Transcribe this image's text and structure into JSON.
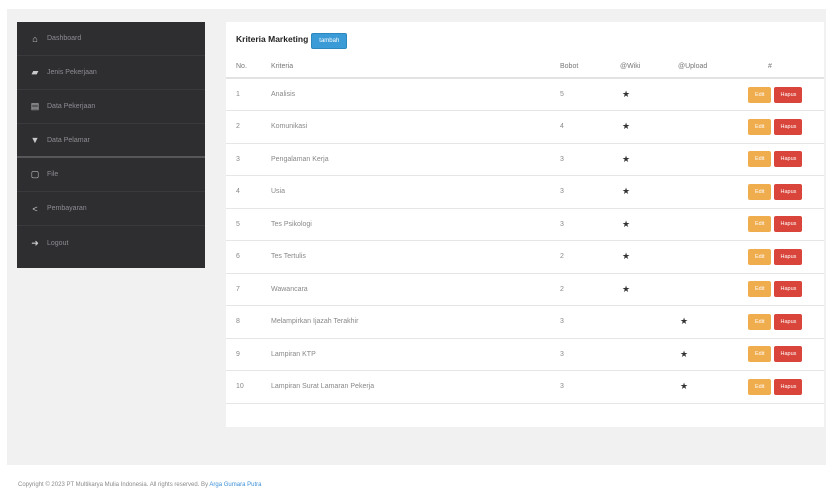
{
  "sidebar": {
    "items": [
      {
        "label": "Dashboard",
        "icon": "home-icon"
      },
      {
        "label": "Jenis Pekerjaan",
        "icon": "briefcase-icon"
      },
      {
        "label": "Data Pekerjaan",
        "icon": "list-icon"
      },
      {
        "label": "Data Pelamar",
        "icon": "users-icon"
      },
      {
        "label": "File",
        "icon": "file-icon"
      },
      {
        "label": "Pembayaran",
        "icon": "share-icon"
      },
      {
        "label": "Logout",
        "icon": "logout-icon"
      }
    ]
  },
  "panel": {
    "title": "Kriteria Marketing",
    "add_button": "tambah"
  },
  "table": {
    "headers": [
      "No.",
      "Kriteria",
      "Bobot",
      "@Wiki",
      "@Upload",
      "#"
    ],
    "rows": [
      {
        "no": "1",
        "kriteria": "Analisis",
        "bobot": "5",
        "wiki": true,
        "upload": false
      },
      {
        "no": "2",
        "kriteria": "Komunikasi",
        "bobot": "4",
        "wiki": true,
        "upload": false
      },
      {
        "no": "3",
        "kriteria": "Pengalaman Kerja",
        "bobot": "3",
        "wiki": true,
        "upload": false
      },
      {
        "no": "4",
        "kriteria": "Usia",
        "bobot": "3",
        "wiki": true,
        "upload": false
      },
      {
        "no": "5",
        "kriteria": "Tes Psikologi",
        "bobot": "3",
        "wiki": true,
        "upload": false
      },
      {
        "no": "6",
        "kriteria": "Tes Tertulis",
        "bobot": "2",
        "wiki": true,
        "upload": false
      },
      {
        "no": "7",
        "kriteria": "Wawancara",
        "bobot": "2",
        "wiki": true,
        "upload": false
      },
      {
        "no": "8",
        "kriteria": "Melampirkan Ijazah Terakhir",
        "bobot": "3",
        "wiki": false,
        "upload": true
      },
      {
        "no": "9",
        "kriteria": "Lampiran KTP",
        "bobot": "3",
        "wiki": false,
        "upload": true
      },
      {
        "no": "10",
        "kriteria": "Lampiran Surat Lamaran Pekerja",
        "bobot": "3",
        "wiki": false,
        "upload": true
      }
    ],
    "edit_label": "Edit",
    "delete_label": "Hapus",
    "star_glyph": "★"
  },
  "footer": {
    "text": "Copyright © 2023 PT Multikarya Mulia Indonesia. All rights reserved. By",
    "link": "Arga Gumara Putra"
  }
}
